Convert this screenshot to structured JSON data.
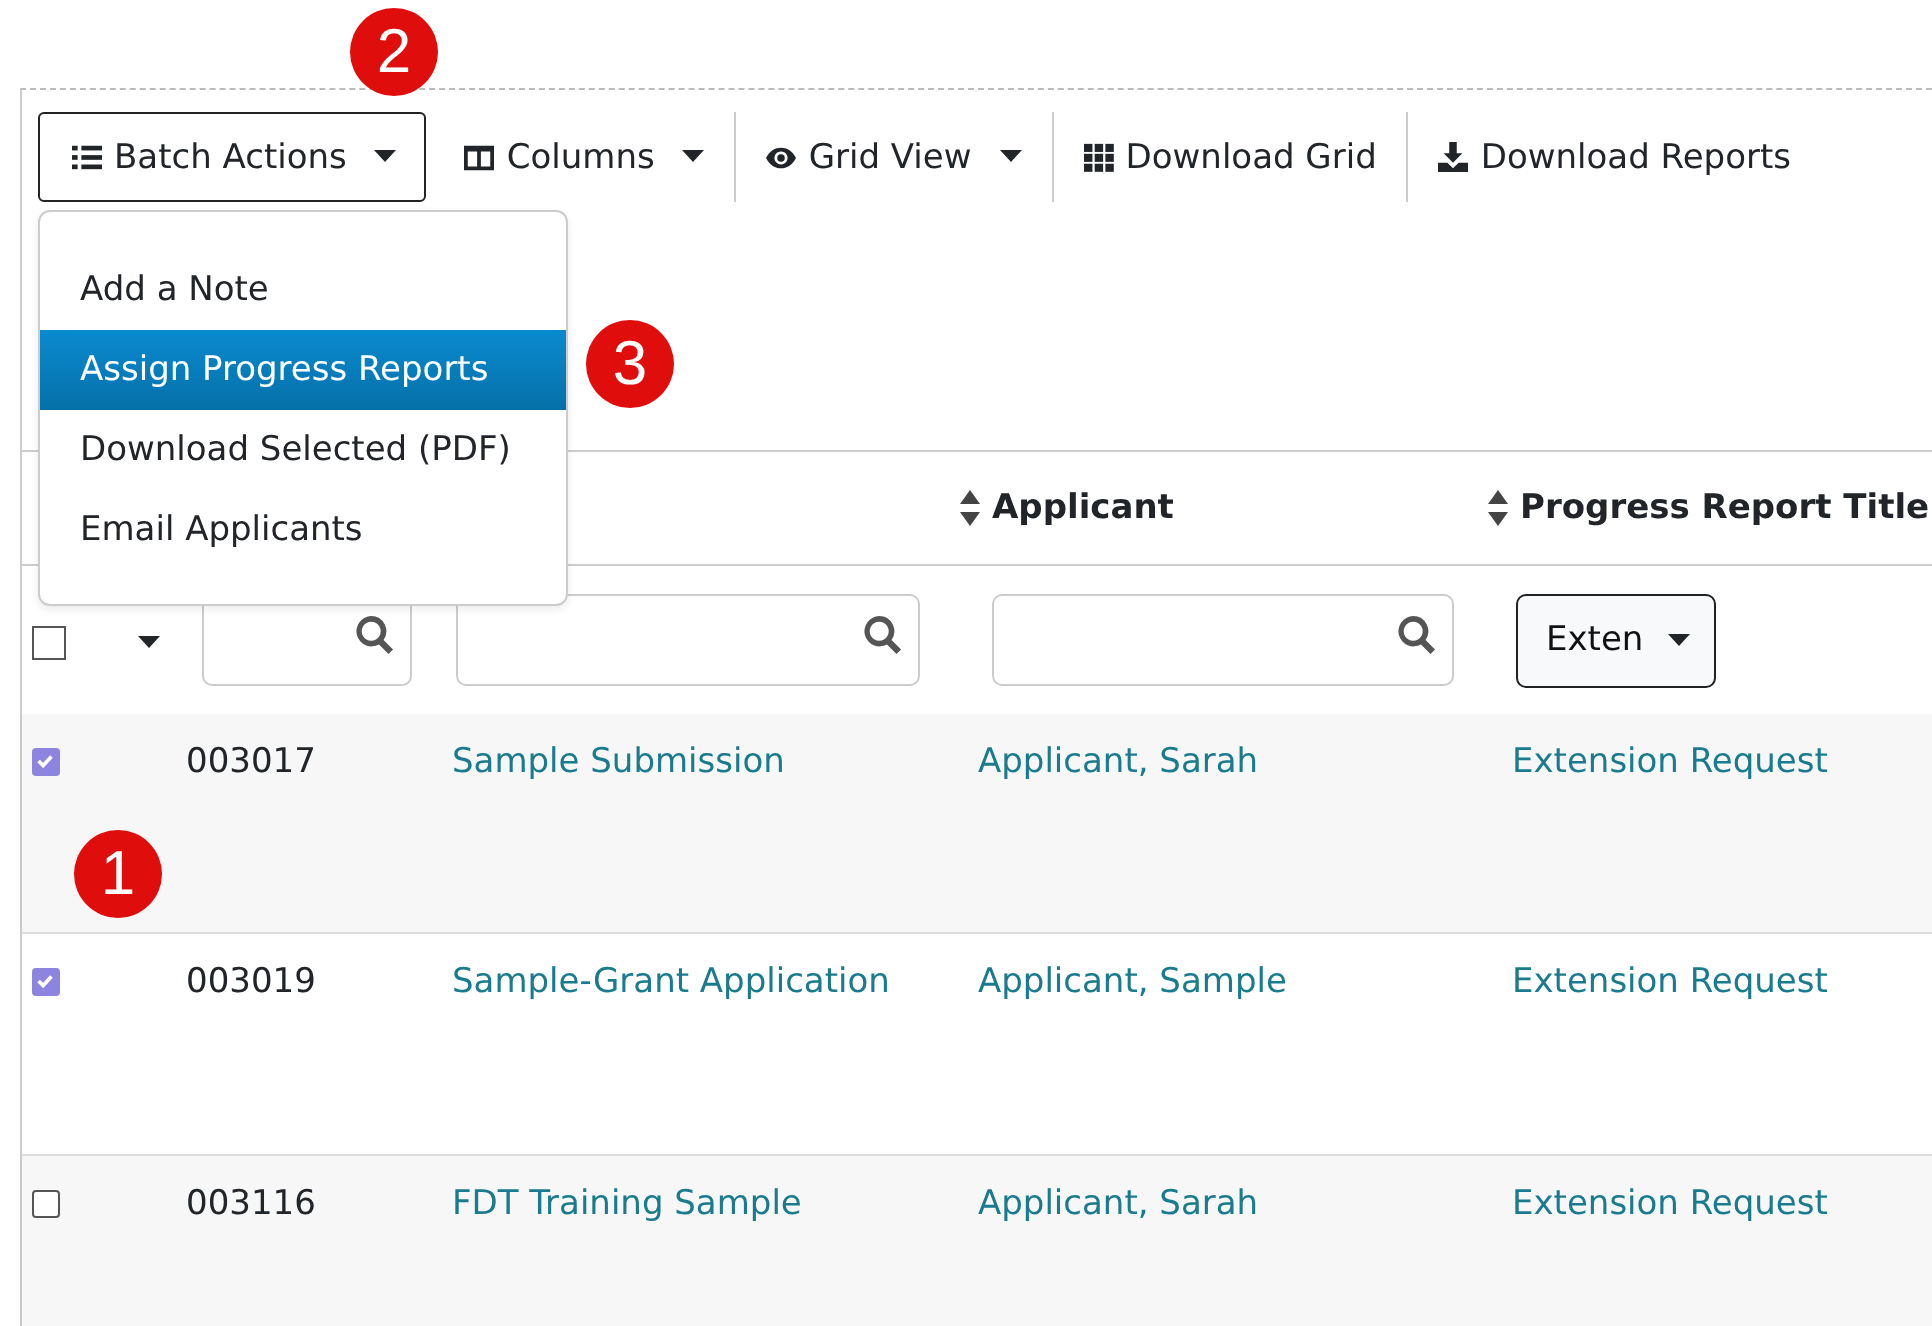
{
  "toolbar": [
    {
      "label": "Batch Actions",
      "caret": true,
      "active": true
    },
    {
      "label": "Columns",
      "caret": true,
      "active": false
    },
    {
      "label": "Grid View",
      "caret": true,
      "active": false
    },
    {
      "label": "Download Grid",
      "caret": false,
      "active": false
    },
    {
      "label": "Download Reports",
      "caret": false,
      "active": false
    }
  ],
  "batch_menu": [
    {
      "label": "Add a Note",
      "selected": false
    },
    {
      "label": "Assign Progress Reports",
      "selected": true
    },
    {
      "label": "Download Selected (PDF)",
      "selected": false
    },
    {
      "label": "Email Applicants",
      "selected": false
    }
  ],
  "table": {
    "columns": [
      {
        "label": "Applicant"
      },
      {
        "label": "Progress Report Title"
      }
    ],
    "filters": [
      {
        "kind": "select-all",
        "checked": false
      },
      {
        "kind": "search"
      },
      {
        "kind": "search"
      },
      {
        "kind": "search"
      },
      {
        "kind": "dropdown",
        "value": "Exten"
      }
    ],
    "rows": [
      {
        "checked": true,
        "id": "003017",
        "submission": "Sample Submission",
        "applicant": "Applicant, Sarah",
        "report": "Extension Request"
      },
      {
        "checked": true,
        "id": "003019",
        "submission": "Sample-Grant Application",
        "applicant": "Applicant, Sample",
        "report": "Extension Request"
      },
      {
        "checked": false,
        "id": "003116",
        "submission": "FDT Training Sample",
        "applicant": "Applicant, Sarah",
        "report": "Extension Request"
      }
    ]
  },
  "callouts": [
    {
      "number": "1"
    },
    {
      "number": "2"
    },
    {
      "number": "3"
    }
  ]
}
